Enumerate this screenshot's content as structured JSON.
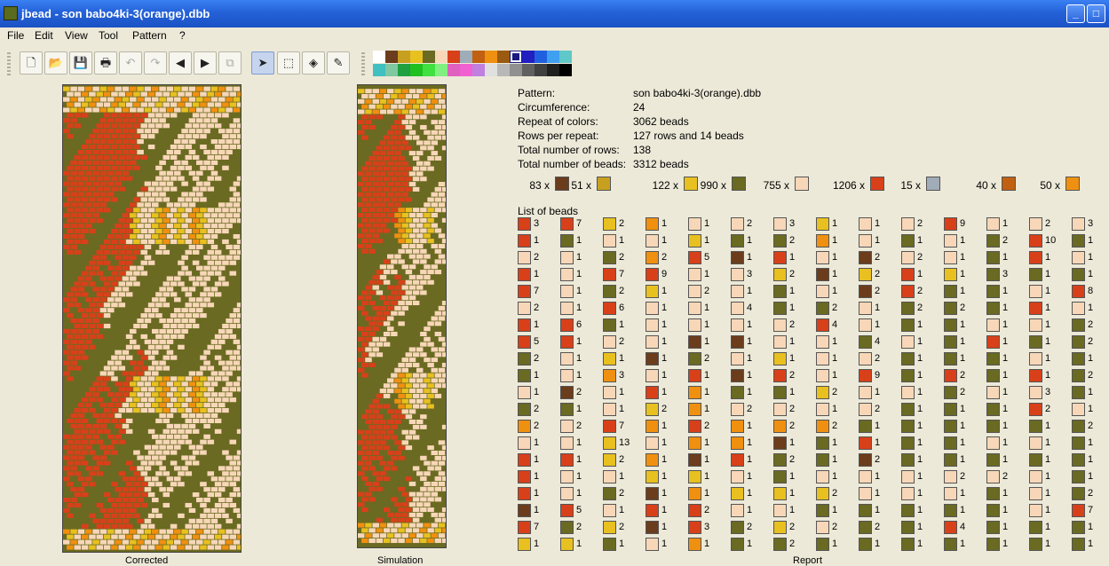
{
  "window": {
    "title": "jbead - son babo4ki-3(orange).dbb",
    "minimize": "_",
    "maximize": "□"
  },
  "menu": [
    "File",
    "Edit",
    "View",
    "Tool",
    "Pattern",
    "?"
  ],
  "toolbar": {
    "buttons": [
      {
        "name": "new-document-icon",
        "glyph": "🗋",
        "state": "normal"
      },
      {
        "name": "open-folder-icon",
        "glyph": "📂",
        "state": "normal"
      },
      {
        "name": "save-icon",
        "glyph": "💾",
        "state": "normal"
      },
      {
        "name": "print-icon",
        "glyph": "🖶",
        "state": "normal"
      },
      {
        "name": "undo-icon",
        "glyph": "↶",
        "state": "disabled"
      },
      {
        "name": "redo-icon",
        "glyph": "↷",
        "state": "disabled"
      },
      {
        "name": "arrow-left-icon",
        "glyph": "◀",
        "state": "normal"
      },
      {
        "name": "arrow-right-icon",
        "glyph": "▶",
        "state": "normal"
      },
      {
        "name": "copy-icon",
        "glyph": "⧉",
        "state": "disabled"
      },
      {
        "name": "pointer-tool-icon",
        "glyph": "➤",
        "state": "selected"
      },
      {
        "name": "select-rect-icon",
        "glyph": "⬚",
        "state": "normal"
      },
      {
        "name": "fill-bucket-icon",
        "glyph": "◈",
        "state": "normal"
      },
      {
        "name": "eyedropper-icon",
        "glyph": "✎",
        "state": "normal"
      }
    ],
    "palette": [
      [
        "#ffffff",
        "#6b3d1c",
        "#c8a020",
        "#e8c020",
        "#6a6a22",
        "#f7d7b8",
        "#d8401a",
        "#a0acb8",
        "#c06010",
        "#f09010",
        "#9a5a10",
        "#1a1a80",
        "#2020c0",
        "#2060e0",
        "#40a0f0",
        "#60c8c8"
      ],
      [
        "#40c0c0",
        "#80c8a0",
        "#20a040",
        "#20c020",
        "#40e040",
        "#80f080",
        "#e060c0",
        "#f060d0",
        "#c080e0",
        "#e0e0e0",
        "#b8b8b8",
        "#909090",
        "#606060",
        "#404040",
        "#202020",
        "#000000"
      ]
    ]
  },
  "views": {
    "corrected_label": "Corrected",
    "simulation_label": "Simulation",
    "report_label": "Report"
  },
  "report": {
    "rows": [
      {
        "k": "Pattern:",
        "v": "son babo4ki-3(orange).dbb"
      },
      {
        "k": "Circumference:",
        "v": "24"
      },
      {
        "k": "Repeat of colors:",
        "v": "3062 beads"
      },
      {
        "k": "Rows per repeat:",
        "v": "127 rows and 14 beads"
      },
      {
        "k": "Total number of rows:",
        "v": "138"
      },
      {
        "k": "Total number of beads:",
        "v": "3312 beads"
      }
    ],
    "color_counts": [
      {
        "n": "83 x",
        "c": "#6b3d1c"
      },
      {
        "n": "51 x",
        "c": "#c8a020"
      },
      {
        "n": "122 x",
        "c": "#e8c020"
      },
      {
        "n": "990 x",
        "c": "#6a6a22"
      },
      {
        "n": "755 x",
        "c": "#f7d7b8"
      },
      {
        "n": "1206 x",
        "c": "#d8401a"
      },
      {
        "n": "15 x",
        "c": "#a0acb8"
      },
      {
        "n": "40 x",
        "c": "#c06010"
      },
      {
        "n": "50 x",
        "c": "#f09010"
      }
    ],
    "list_title": "List of beads",
    "bead_list": [
      [
        [
          "R",
          "3"
        ],
        [
          "R",
          "1"
        ],
        [
          "P",
          "2"
        ],
        [
          "R",
          "1"
        ],
        [
          "R",
          "7"
        ],
        [
          "P",
          "2"
        ],
        [
          "R",
          "1"
        ],
        [
          "R",
          "5"
        ],
        [
          "G",
          "2"
        ],
        [
          "G",
          "1"
        ],
        [
          "P",
          "1"
        ],
        [
          "G",
          "2"
        ],
        [
          "O",
          "2"
        ],
        [
          "P",
          "1"
        ],
        [
          "R",
          "1"
        ],
        [
          "R",
          "1"
        ],
        [
          "R",
          "1"
        ],
        [
          "B",
          "1"
        ],
        [
          "R",
          "7"
        ],
        [
          "Y",
          "1"
        ]
      ],
      [
        [
          "R",
          "7"
        ],
        [
          "G",
          "1"
        ],
        [
          "P",
          "1"
        ],
        [
          "P",
          "1"
        ],
        [
          "P",
          "1"
        ],
        [
          "P",
          "1"
        ],
        [
          "R",
          "6"
        ],
        [
          "R",
          "1"
        ],
        [
          "P",
          "1"
        ],
        [
          "P",
          "1"
        ],
        [
          "B",
          "2"
        ],
        [
          "G",
          "1"
        ],
        [
          "P",
          "2"
        ],
        [
          "P",
          "1"
        ],
        [
          "R",
          "1"
        ],
        [
          "P",
          "1"
        ],
        [
          "P",
          "1"
        ],
        [
          "R",
          "5"
        ],
        [
          "G",
          "2"
        ],
        [
          "Y",
          "1"
        ]
      ],
      [
        [
          "Y",
          "2"
        ],
        [
          "P",
          "1"
        ],
        [
          "G",
          "2"
        ],
        [
          "R",
          "7"
        ],
        [
          "G",
          "2"
        ],
        [
          "R",
          "6"
        ],
        [
          "G",
          "1"
        ],
        [
          "P",
          "2"
        ],
        [
          "Y",
          "1"
        ],
        [
          "O",
          "3"
        ],
        [
          "P",
          "1"
        ],
        [
          "P",
          "1"
        ],
        [
          "R",
          "7"
        ],
        [
          "Y",
          "13"
        ],
        [
          "Y",
          "2"
        ],
        [
          "P",
          "1"
        ],
        [
          "G",
          "2"
        ],
        [
          "P",
          "1"
        ],
        [
          "Y",
          "2"
        ],
        [
          "G",
          "1"
        ]
      ],
      [
        [
          "O",
          "1"
        ],
        [
          "P",
          "1"
        ],
        [
          "O",
          "2"
        ],
        [
          "R",
          "9"
        ],
        [
          "Y",
          "1"
        ],
        [
          "P",
          "1"
        ],
        [
          "P",
          "1"
        ],
        [
          "P",
          "1"
        ],
        [
          "B",
          "1"
        ],
        [
          "P",
          "1"
        ],
        [
          "R",
          "1"
        ],
        [
          "Y",
          "2"
        ],
        [
          "O",
          "1"
        ],
        [
          "P",
          "1"
        ],
        [
          "O",
          "1"
        ],
        [
          "Y",
          "1"
        ],
        [
          "B",
          "1"
        ],
        [
          "R",
          "1"
        ],
        [
          "B",
          "1"
        ],
        [
          "P",
          "1"
        ]
      ],
      [
        [
          "P",
          "1"
        ],
        [
          "Y",
          "1"
        ],
        [
          "R",
          "5"
        ],
        [
          "P",
          "1"
        ],
        [
          "P",
          "2"
        ],
        [
          "P",
          "1"
        ],
        [
          "P",
          "1"
        ],
        [
          "B",
          "1"
        ],
        [
          "G",
          "2"
        ],
        [
          "R",
          "1"
        ],
        [
          "O",
          "1"
        ],
        [
          "O",
          "1"
        ],
        [
          "R",
          "2"
        ],
        [
          "O",
          "1"
        ],
        [
          "B",
          "1"
        ],
        [
          "Y",
          "1"
        ],
        [
          "O",
          "1"
        ],
        [
          "R",
          "2"
        ],
        [
          "R",
          "3"
        ],
        [
          "O",
          "1"
        ]
      ],
      [
        [
          "P",
          "2"
        ],
        [
          "G",
          "1"
        ],
        [
          "B",
          "1"
        ],
        [
          "P",
          "3"
        ],
        [
          "P",
          "1"
        ],
        [
          "P",
          "4"
        ],
        [
          "P",
          "1"
        ],
        [
          "B",
          "1"
        ],
        [
          "P",
          "1"
        ],
        [
          "B",
          "1"
        ],
        [
          "G",
          "1"
        ],
        [
          "P",
          "2"
        ],
        [
          "O",
          "1"
        ],
        [
          "O",
          "1"
        ],
        [
          "R",
          "1"
        ],
        [
          "P",
          "1"
        ],
        [
          "Y",
          "1"
        ],
        [
          "P",
          "1"
        ],
        [
          "G",
          "2"
        ],
        [
          "G",
          "1"
        ]
      ],
      [
        [
          "P",
          "3"
        ],
        [
          "G",
          "2"
        ],
        [
          "R",
          "1"
        ],
        [
          "Y",
          "2"
        ],
        [
          "G",
          "1"
        ],
        [
          "G",
          "1"
        ],
        [
          "P",
          "2"
        ],
        [
          "P",
          "1"
        ],
        [
          "Y",
          "1"
        ],
        [
          "R",
          "2"
        ],
        [
          "G",
          "1"
        ],
        [
          "P",
          "2"
        ],
        [
          "O",
          "2"
        ],
        [
          "B",
          "1"
        ],
        [
          "G",
          "2"
        ],
        [
          "G",
          "1"
        ],
        [
          "Y",
          "1"
        ],
        [
          "P",
          "1"
        ],
        [
          "Y",
          "2"
        ],
        [
          "G",
          "2"
        ]
      ],
      [
        [
          "Y",
          "1"
        ],
        [
          "O",
          "1"
        ],
        [
          "P",
          "1"
        ],
        [
          "B",
          "1"
        ],
        [
          "P",
          "1"
        ],
        [
          "G",
          "2"
        ],
        [
          "R",
          "4"
        ],
        [
          "P",
          "1"
        ],
        [
          "P",
          "1"
        ],
        [
          "P",
          "1"
        ],
        [
          "Y",
          "2"
        ],
        [
          "P",
          "1"
        ],
        [
          "O",
          "2"
        ],
        [
          "G",
          "1"
        ],
        [
          "G",
          "1"
        ],
        [
          "P",
          "1"
        ],
        [
          "Y",
          "2"
        ],
        [
          "G",
          "1"
        ],
        [
          "P",
          "2"
        ],
        [
          "G",
          "1"
        ]
      ],
      [
        [
          "P",
          "1"
        ],
        [
          "P",
          "1"
        ],
        [
          "B",
          "2"
        ],
        [
          "Y",
          "2"
        ],
        [
          "B",
          "2"
        ],
        [
          "P",
          "1"
        ],
        [
          "P",
          "1"
        ],
        [
          "G",
          "4"
        ],
        [
          "P",
          "2"
        ],
        [
          "R",
          "9"
        ],
        [
          "P",
          "1"
        ],
        [
          "P",
          "2"
        ],
        [
          "G",
          "1"
        ],
        [
          "R",
          "1"
        ],
        [
          "B",
          "2"
        ],
        [
          "P",
          "1"
        ],
        [
          "P",
          "1"
        ],
        [
          "G",
          "1"
        ],
        [
          "G",
          "2"
        ],
        [
          "G",
          "1"
        ]
      ],
      [
        [
          "P",
          "2"
        ],
        [
          "G",
          "1"
        ],
        [
          "P",
          "2"
        ],
        [
          "R",
          "1"
        ],
        [
          "R",
          "2"
        ],
        [
          "G",
          "2"
        ],
        [
          "G",
          "1"
        ],
        [
          "P",
          "1"
        ],
        [
          "G",
          "1"
        ],
        [
          "G",
          "1"
        ],
        [
          "P",
          "1"
        ],
        [
          "G",
          "1"
        ],
        [
          "G",
          "1"
        ],
        [
          "G",
          "1"
        ],
        [
          "G",
          "1"
        ],
        [
          "P",
          "1"
        ],
        [
          "P",
          "1"
        ],
        [
          "G",
          "1"
        ],
        [
          "G",
          "1"
        ],
        [
          "G",
          "1"
        ]
      ],
      [
        [
          "R",
          "9"
        ],
        [
          "P",
          "1"
        ],
        [
          "P",
          "1"
        ],
        [
          "Y",
          "1"
        ],
        [
          "G",
          "1"
        ],
        [
          "G",
          "2"
        ],
        [
          "G",
          "1"
        ],
        [
          "G",
          "1"
        ],
        [
          "G",
          "1"
        ],
        [
          "R",
          "2"
        ],
        [
          "G",
          "2"
        ],
        [
          "G",
          "1"
        ],
        [
          "G",
          "1"
        ],
        [
          "G",
          "1"
        ],
        [
          "G",
          "1"
        ],
        [
          "P",
          "2"
        ],
        [
          "P",
          "1"
        ],
        [
          "G",
          "1"
        ],
        [
          "R",
          "4"
        ],
        [
          "G",
          "1"
        ]
      ],
      [
        [
          "P",
          "1"
        ],
        [
          "G",
          "2"
        ],
        [
          "G",
          "1"
        ],
        [
          "G",
          "3"
        ],
        [
          "G",
          "1"
        ],
        [
          "G",
          "1"
        ],
        [
          "P",
          "1"
        ],
        [
          "R",
          "1"
        ],
        [
          "G",
          "1"
        ],
        [
          "G",
          "1"
        ],
        [
          "P",
          "1"
        ],
        [
          "G",
          "1"
        ],
        [
          "G",
          "1"
        ],
        [
          "P",
          "1"
        ],
        [
          "G",
          "1"
        ],
        [
          "P",
          "2"
        ],
        [
          "G",
          "1"
        ],
        [
          "G",
          "1"
        ],
        [
          "G",
          "1"
        ],
        [
          "G",
          "1"
        ]
      ],
      [
        [
          "P",
          "2"
        ],
        [
          "R",
          "10"
        ],
        [
          "R",
          "1"
        ],
        [
          "G",
          "1"
        ],
        [
          "P",
          "1"
        ],
        [
          "R",
          "1"
        ],
        [
          "P",
          "1"
        ],
        [
          "G",
          "1"
        ],
        [
          "P",
          "1"
        ],
        [
          "R",
          "1"
        ],
        [
          "P",
          "3"
        ],
        [
          "R",
          "2"
        ],
        [
          "G",
          "1"
        ],
        [
          "P",
          "1"
        ],
        [
          "G",
          "1"
        ],
        [
          "P",
          "1"
        ],
        [
          "P",
          "1"
        ],
        [
          "P",
          "1"
        ],
        [
          "G",
          "1"
        ],
        [
          "G",
          "1"
        ]
      ],
      [
        [
          "P",
          "3"
        ],
        [
          "G",
          "1"
        ],
        [
          "P",
          "1"
        ],
        [
          "G",
          "1"
        ],
        [
          "R",
          "8"
        ],
        [
          "P",
          "1"
        ],
        [
          "G",
          "2"
        ],
        [
          "G",
          "2"
        ],
        [
          "G",
          "1"
        ],
        [
          "G",
          "2"
        ],
        [
          "G",
          "1"
        ],
        [
          "P",
          "1"
        ],
        [
          "G",
          "2"
        ],
        [
          "G",
          "1"
        ],
        [
          "G",
          "1"
        ],
        [
          "G",
          "1"
        ],
        [
          "G",
          "2"
        ],
        [
          "R",
          "7"
        ],
        [
          "G",
          "1"
        ],
        [
          "G",
          "1"
        ]
      ]
    ]
  },
  "bead_colors": {
    "R": "#d8401a",
    "G": "#6a6a22",
    "P": "#f7d7b8",
    "Y": "#e8c020",
    "O": "#f09010",
    "B": "#6b3d1c",
    "S": "#a0acb8"
  }
}
